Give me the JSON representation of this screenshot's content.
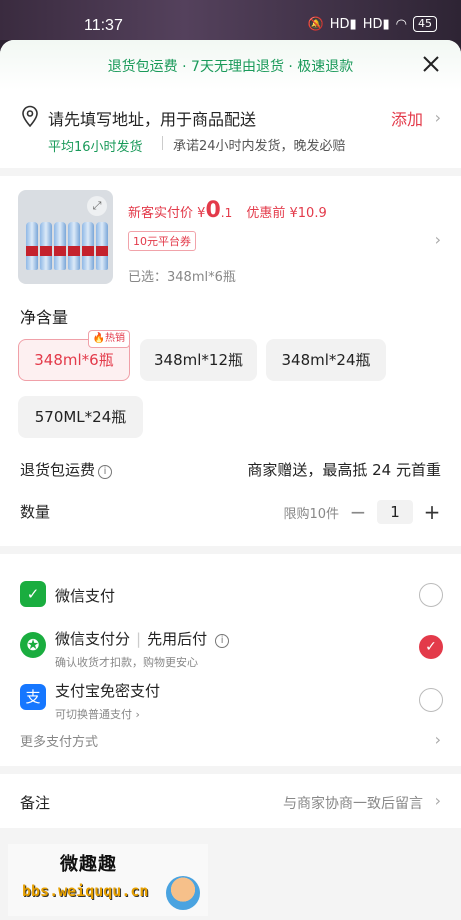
{
  "status_bar": {
    "time": "11:37",
    "signal1": "HD",
    "signal2": "HD",
    "battery": "45"
  },
  "banner": {
    "text": "退货包运费 · 7天无理由退货 · 极速退款"
  },
  "address": {
    "prompt": "请先填写地址，用于商品配送",
    "add_label": "添加",
    "ship_avg": "平均16小时发货",
    "ship_promise": "承诺24小时内发货，晚发必赔"
  },
  "product": {
    "price_prefix": "新客实付价",
    "currency": "¥",
    "price_int": "0",
    "price_dec": ".1",
    "orig_label": "优惠前",
    "orig_price": "¥10.9",
    "coupon": "10元平台券",
    "selected": "已选：348ml*6瓶"
  },
  "spec": {
    "title": "净含量",
    "hot_tag": "热销",
    "options": [
      "348ml*6瓶",
      "348ml*12瓶",
      "348ml*24瓶",
      "570ML*24瓶"
    ]
  },
  "return_shipping": {
    "label": "退货包运费",
    "value": "商家赠送，最高抵 24 元首重"
  },
  "quantity": {
    "label": "数量",
    "limit": "限购10件",
    "value": "1"
  },
  "payment": {
    "wechat": {
      "name": "微信支付"
    },
    "wechat_score": {
      "name": "微信支付分",
      "tag": "先用后付",
      "sub": "确认收货才扣款，购物更安心"
    },
    "alipay": {
      "name": "支付宝免密支付",
      "sub": "可切换普通支付",
      "icon_char": "支"
    },
    "more": "更多支付方式"
  },
  "remark": {
    "label": "备注",
    "placeholder": "与商家协商一致后留言"
  },
  "watermark": {
    "line1": "微趣趣",
    "line2": "bbs.weiququ.cn"
  }
}
